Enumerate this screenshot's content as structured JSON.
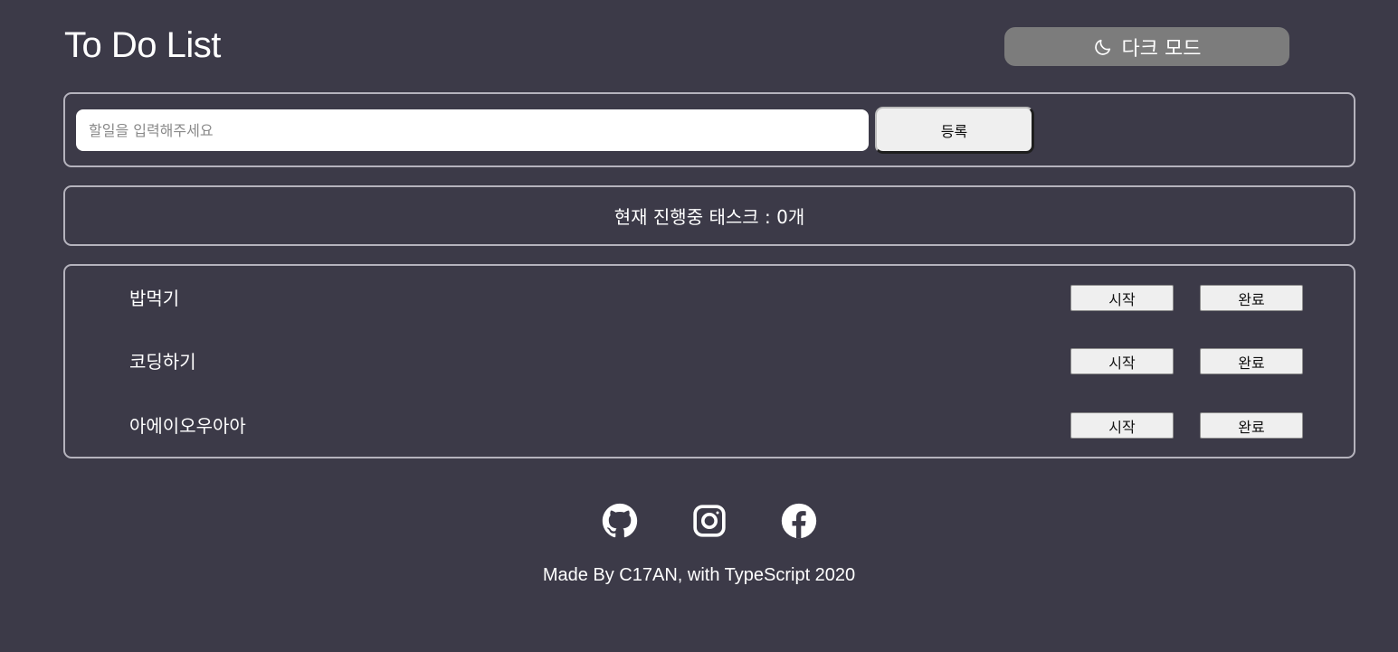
{
  "header": {
    "title": "To Do List",
    "dark_mode_label": "다크 모드",
    "dark_mode_icon": "moon-icon"
  },
  "input": {
    "placeholder": "할일을 입력해주세요",
    "value": "",
    "register_label": "등록"
  },
  "status": {
    "text": "현재 진행중 태스크 : 0개"
  },
  "todos": [
    {
      "text": "밥먹기",
      "start_label": "시작",
      "done_label": "완료"
    },
    {
      "text": "코딩하기",
      "start_label": "시작",
      "done_label": "완료"
    },
    {
      "text": "아에이오우아아",
      "start_label": "시작",
      "done_label": "완료"
    }
  ],
  "social": [
    "github-icon",
    "instagram-icon",
    "facebook-icon"
  ],
  "footer": {
    "text": "Made By C17AN, with TypeScript 2020"
  },
  "colors": {
    "background": "#3c3a48",
    "panel_border": "#b5b3bd",
    "dark_mode_button": "#7c7c7c",
    "button_bg": "#efefef",
    "text": "#ffffff"
  }
}
